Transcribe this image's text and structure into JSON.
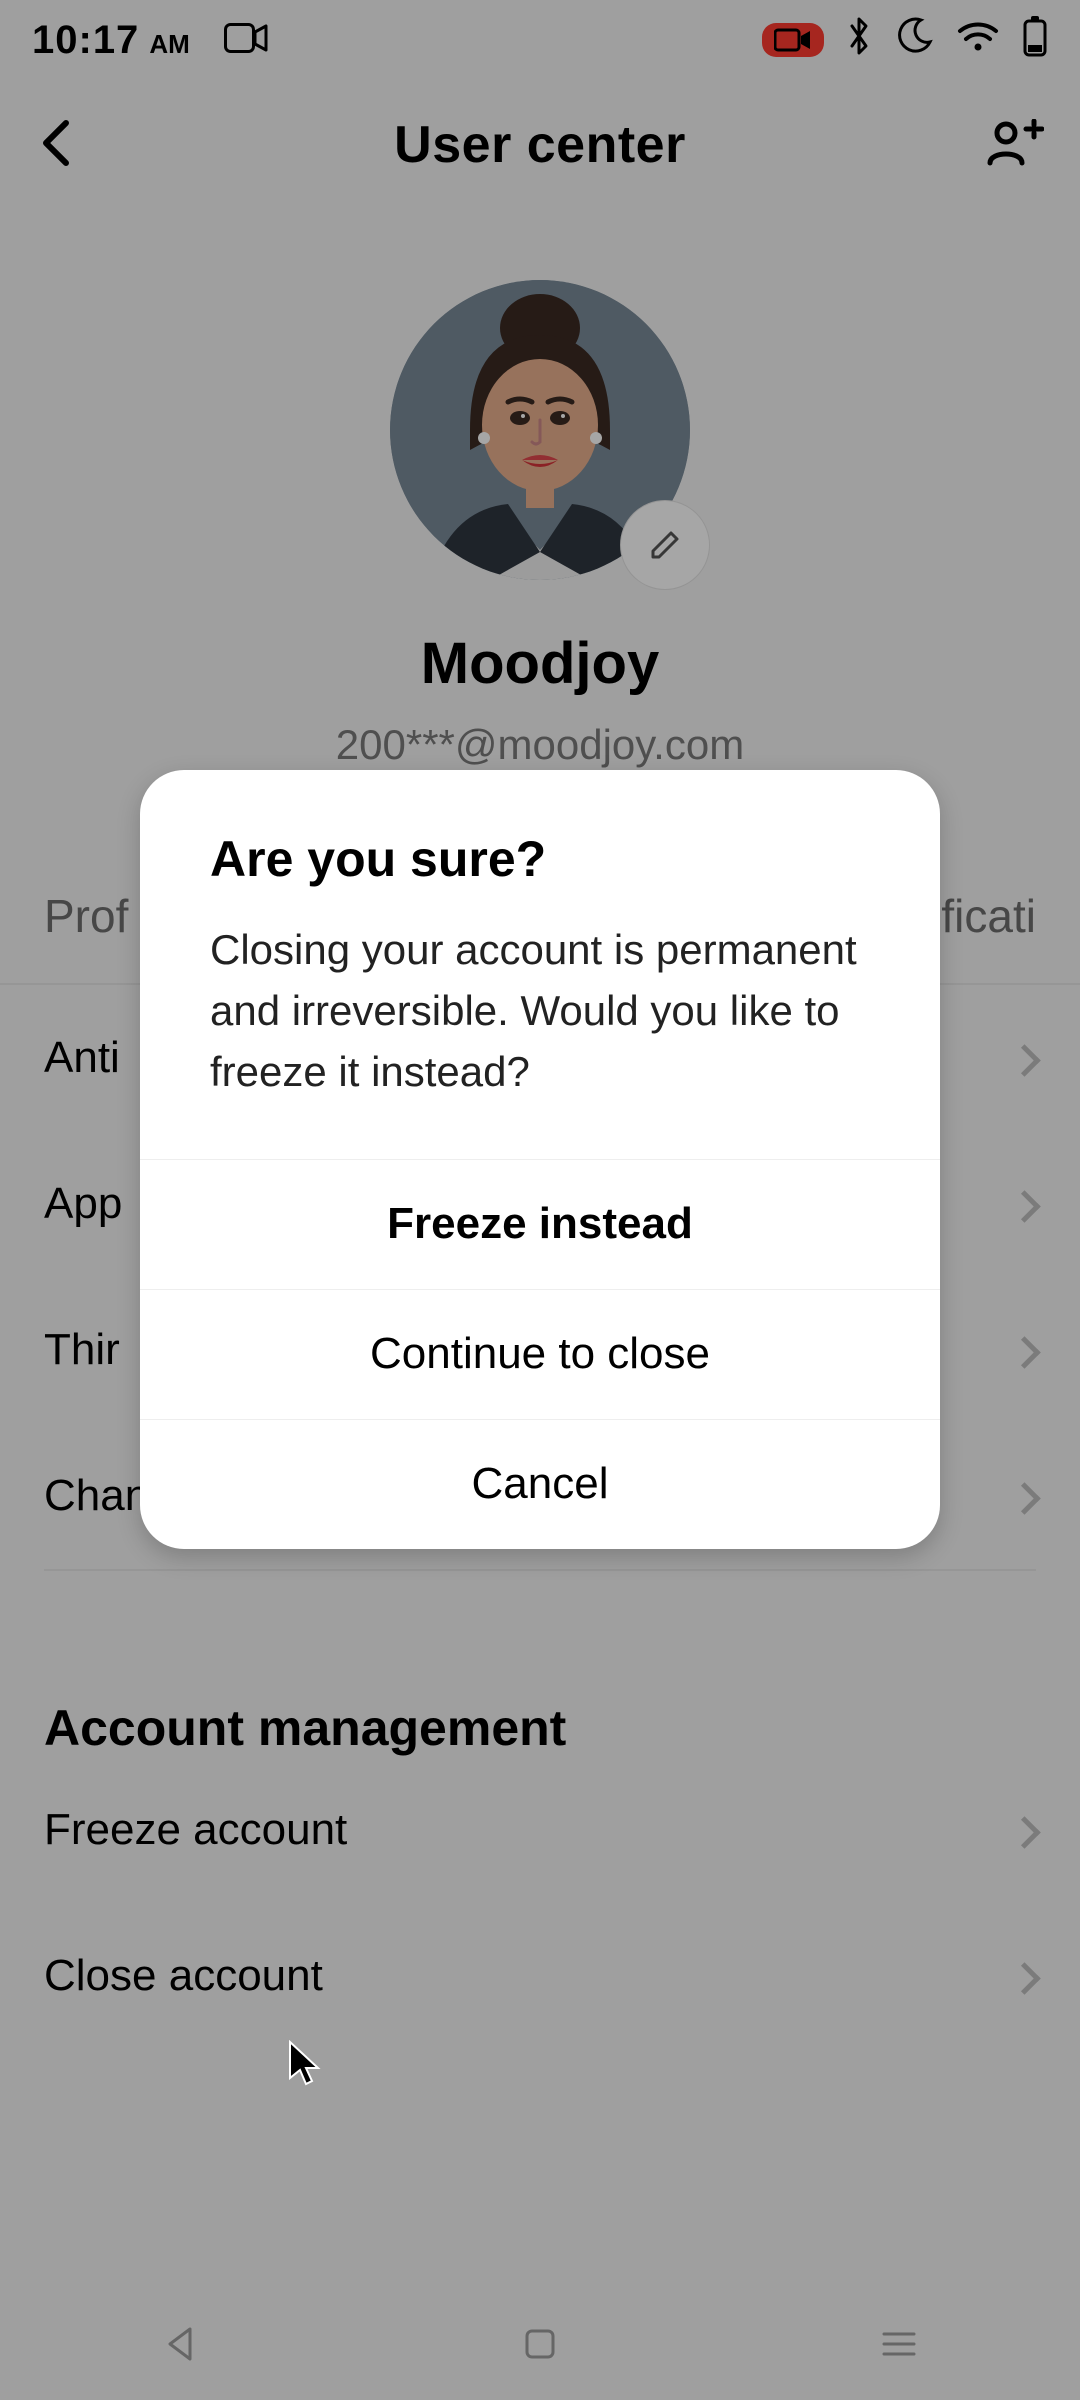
{
  "status": {
    "time": "10:17",
    "ampm": "AM"
  },
  "header": {
    "title": "User center"
  },
  "profile": {
    "username": "Moodjoy",
    "email": "200***@moodjoy.com"
  },
  "tabs": {
    "left": "Prof",
    "right": "ficati"
  },
  "rows": {
    "r0": "Anti",
    "r1": "App",
    "r2": "Thir",
    "r3": "Channel verification"
  },
  "section": {
    "title": "Account management",
    "freeze": "Freeze account",
    "close": "Close account"
  },
  "dialog": {
    "title": "Are you sure?",
    "message": "Closing your account is permanent and irreversible. Would you like to freeze it instead?",
    "freeze": "Freeze instead",
    "continue": "Continue to close",
    "cancel": "Cancel"
  }
}
